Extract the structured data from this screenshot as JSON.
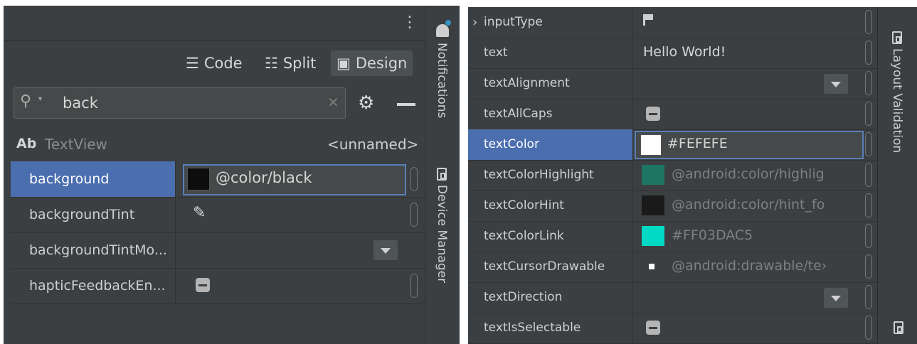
{
  "left_panel": {
    "modes": [
      {
        "label": "Code",
        "icon": "code-lines-icon"
      },
      {
        "label": "Split",
        "icon": "split-icon"
      },
      {
        "label": "Design",
        "icon": "image-icon"
      }
    ],
    "search": {
      "value": "back",
      "placeholder": ""
    },
    "component": {
      "badge": "Ab",
      "class_name": "TextView",
      "id": "<unnamed>"
    },
    "attributes": [
      {
        "name": "background",
        "value": "@color/black",
        "swatch": "#0d0d0d",
        "selected": true
      },
      {
        "name": "backgroundTint",
        "value": "",
        "editor": "color-picker"
      },
      {
        "name": "backgroundTintMo...",
        "value": "",
        "editor": "dropdown"
      },
      {
        "name": "hapticFeedbackEn...",
        "value": "",
        "editor": "checkbox"
      }
    ]
  },
  "left_toolstrip": {
    "notifications_label": "Notifications",
    "device_manager_label": "Device Manager"
  },
  "right_panel": {
    "attributes": [
      {
        "name": "inputType",
        "value": "",
        "editor": "flag",
        "expandable": true
      },
      {
        "name": "text",
        "value": "Hello World!"
      },
      {
        "name": "textAlignment",
        "value": "",
        "editor": "dropdown"
      },
      {
        "name": "textAllCaps",
        "value": "",
        "editor": "checkbox"
      },
      {
        "name": "textColor",
        "value": "#FEFEFE",
        "swatch": "#fefefe",
        "selected": true
      },
      {
        "name": "textColorHighlight",
        "value": "@android:color/highlig",
        "swatch": "#1f7563"
      },
      {
        "name": "textColorHint",
        "value": "@android:color/hint_fo",
        "swatch": "#1a1a1a"
      },
      {
        "name": "textColorLink",
        "value": "#FF03DAC5",
        "swatch": "#03dac5"
      },
      {
        "name": "textCursorDrawable",
        "value": "@android:drawable/te›",
        "swatch": "#ffffff",
        "small_swatch": true
      },
      {
        "name": "textDirection",
        "value": "",
        "editor": "dropdown"
      },
      {
        "name": "textIsSelectable",
        "value": "",
        "editor": "checkbox"
      }
    ]
  },
  "right_toolstrip": {
    "layout_validation_label": "Layout Validation"
  },
  "colors": {
    "panel_bg": "#3c3f41",
    "selection": "#4b6eaf",
    "focus_border": "#5a7fb9"
  }
}
